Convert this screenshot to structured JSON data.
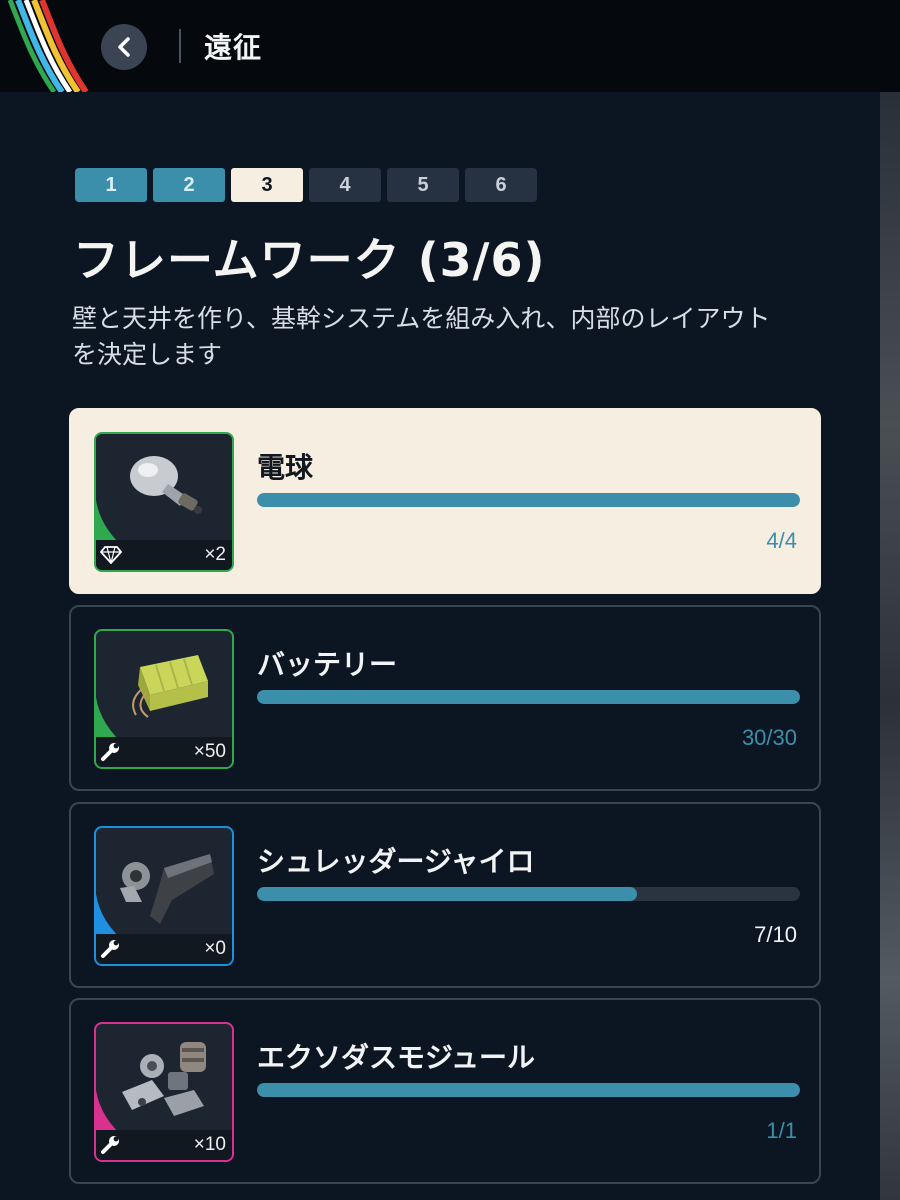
{
  "header": {
    "title": "遠征"
  },
  "steps": [
    {
      "label": "1",
      "state": "done"
    },
    {
      "label": "2",
      "state": "done"
    },
    {
      "label": "3",
      "state": "current"
    },
    {
      "label": "4",
      "state": "todo"
    },
    {
      "label": "5",
      "state": "todo"
    },
    {
      "label": "6",
      "state": "todo"
    }
  ],
  "stage": {
    "title": "フレームワーク (3/6)",
    "description": "壁と天井を作り、基幹システムを組み入れ、内部のレイアウトを決定します"
  },
  "items": [
    {
      "name": "電球",
      "owned": "×2",
      "owned_icon": "diamond-icon",
      "progress": "4/4",
      "fraction": 1.0,
      "rarity_color": "#2fa84f"
    },
    {
      "name": "バッテリー",
      "owned": "×50",
      "owned_icon": "wrench-icon",
      "progress": "30/30",
      "fraction": 1.0,
      "rarity_color": "#2fa84f"
    },
    {
      "name": "シュレッダージャイロ",
      "owned": "×0",
      "owned_icon": "wrench-icon",
      "progress": "7/10",
      "fraction": 0.7,
      "rarity_color": "#1f8fe0"
    },
    {
      "name": "エクソダスモジュール",
      "owned": "×10",
      "owned_icon": "wrench-icon",
      "progress": "1/1",
      "fraction": 1.0,
      "rarity_color": "#d8318f"
    }
  ],
  "colors": {
    "accent": "#3b8fab",
    "highlight": "#f7eee2"
  }
}
